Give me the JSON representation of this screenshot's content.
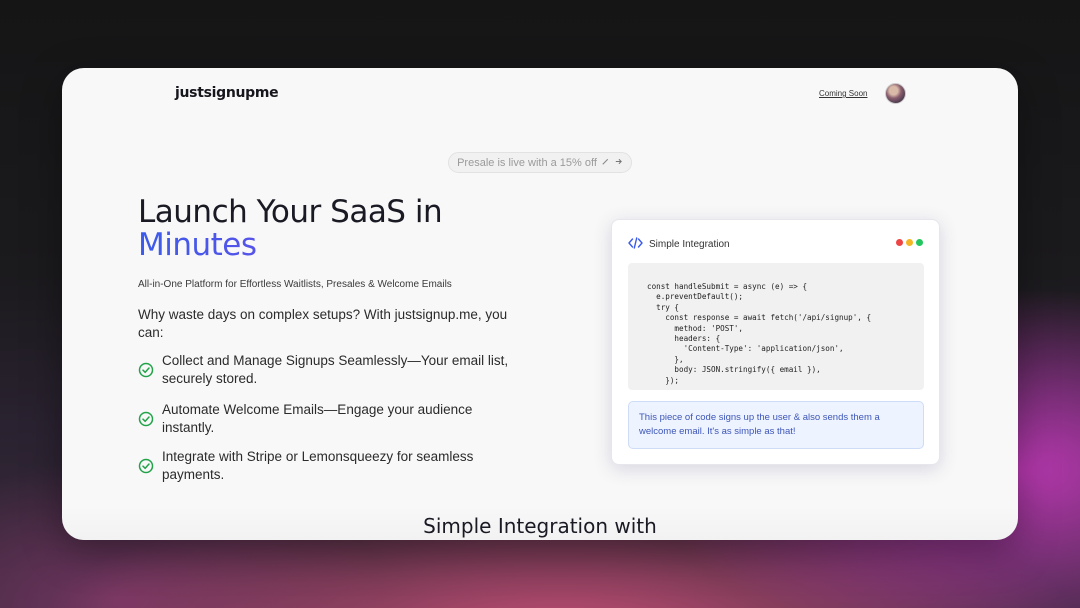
{
  "header": {
    "logo": "justsignupme",
    "nav_link": "Coming Soon"
  },
  "hero": {
    "pill_text": "Presale is live with a 15% off",
    "title_line1": "Launch Your SaaS in",
    "title_line2": "Minutes",
    "tagline": "All-in-One Platform for Effortless Waitlists, Presales & Welcome Emails",
    "lead": "Why waste days on complex setups? With justsignup.me, you can:",
    "features": [
      "Collect and Manage Signups Seamlessly—Your email list, securely stored.",
      "Automate Welcome Emails—Engage your audience instantly.",
      "Integrate with Stripe or Lemonsqueezy for seamless payments."
    ]
  },
  "card": {
    "title": "Simple Integration",
    "code": "const handleSubmit = async (e) => {\n  e.preventDefault();\n  try {\n    const response = await fetch('/api/signup', {\n      method: 'POST',\n      headers: {\n        'Content-Type': 'application/json',\n      },\n      body: JSON.stringify({ email }),\n    });",
    "note": "This piece of code signs up the user & also sends them a welcome email. It's as simple as that!",
    "dot_colors": [
      "#ef4444",
      "#f5b623",
      "#22c55e"
    ]
  },
  "section": {
    "title": "Simple Integration with"
  },
  "colors": {
    "accent_start": "#3b5bea",
    "accent_end": "#9b57e8",
    "check": "#22a34a"
  }
}
